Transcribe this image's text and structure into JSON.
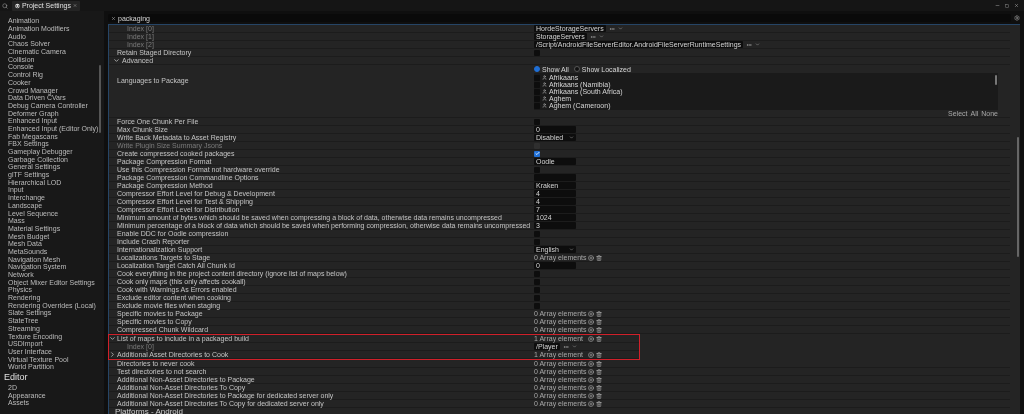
{
  "window": {
    "tab_title": "Project Settings"
  },
  "sidebar": {
    "items": [
      "Animation",
      "Animation Modifiers",
      "Audio",
      "Chaos Solver",
      "Cinematic Camera",
      "Collision",
      "Console",
      "Control Rig",
      "Cooker",
      "Crowd Manager",
      "Data Driven CVars",
      "Debug Camera Controller",
      "Deformer Graph",
      "Enhanced Input",
      "Enhanced Input (Editor Only)",
      "Fab Megascans",
      "FBX Settings",
      "Gameplay Debugger",
      "Garbage Collection",
      "General Settings",
      "glTF Settings",
      "Hierarchical LOD",
      "Input",
      "Interchange",
      "Landscape",
      "Level Sequence",
      "Mass",
      "Material Settings",
      "Mesh Budget",
      "Mesh Data",
      "MetaSounds",
      "Navigation Mesh",
      "Navigation System",
      "Network",
      "Object Mixer Editor Settings",
      "Physics",
      "Rendering",
      "Rendering Overrides (Local)",
      "Slate Settings",
      "StateTree",
      "Streaming",
      "Texture Encoding",
      "USDImport",
      "User Interface",
      "Virtual Texture Pool",
      "World Partition"
    ],
    "editor_section": {
      "heading": "Editor",
      "items": [
        "2D",
        "Appearance",
        "Assets"
      ]
    }
  },
  "search": {
    "value": "packaging"
  },
  "rows": [
    {
      "kind": "index",
      "label": "Index [0]",
      "value": "HordeStorageServers"
    },
    {
      "kind": "index",
      "label": "Index [1]",
      "value": "StorageServers"
    },
    {
      "kind": "index",
      "label": "Index [2]",
      "value": "/Script/AndroidFileServerEditor.AndroidFileServerRuntimeSettings"
    },
    {
      "kind": "checkbox",
      "label": "Retain Staged Directory",
      "checked": false,
      "disabled": false
    },
    {
      "kind": "section",
      "label": "Advanced",
      "expanded": true
    },
    {
      "kind": "languages",
      "label": "Languages to Package",
      "filters": [
        {
          "label": "Show All",
          "selected": true
        },
        {
          "label": "Show Localized",
          "selected": false
        }
      ],
      "languages": [
        {
          "name": "Afrikaans",
          "checked": false
        },
        {
          "name": "Afrikaans (Namibia)",
          "checked": false
        },
        {
          "name": "Afrikaans (South Africa)",
          "checked": false
        },
        {
          "name": "Aghem",
          "checked": false
        },
        {
          "name": "Aghem (Cameroon)",
          "checked": false
        }
      ],
      "select_label": "Select",
      "select_links": [
        "All",
        "None"
      ]
    },
    {
      "kind": "checkbox",
      "label": "Force One Chunk Per File",
      "checked": false,
      "disabled": false
    },
    {
      "kind": "field",
      "label": "Max Chunk Size",
      "value": "0"
    },
    {
      "kind": "dropdown",
      "label": "Write Back Metadata to Asset Registry",
      "value": "Disabled"
    },
    {
      "kind": "checkbox",
      "label": "Write Plugin Size Summary Jsons",
      "checked": false,
      "disabled": true
    },
    {
      "kind": "checkbox",
      "label": "Create compressed cooked packages",
      "checked": true,
      "disabled": false
    },
    {
      "kind": "field",
      "label": "Package Compression Format",
      "value": "Oodle"
    },
    {
      "kind": "checkbox",
      "label": "Use this Compression Format not hardware override",
      "checked": false,
      "disabled": false
    },
    {
      "kind": "field",
      "label": "Package Compression Commandline Options",
      "value": ""
    },
    {
      "kind": "field",
      "label": "Package Compression Method",
      "value": "Kraken"
    },
    {
      "kind": "field",
      "label": "Compressor Effort Level for Debug & Development",
      "value": "4"
    },
    {
      "kind": "field",
      "label": "Compressor Effort Level for Test & Shipping",
      "value": "4"
    },
    {
      "kind": "field",
      "label": "Compressor Effort Level for Distribution",
      "value": "7"
    },
    {
      "kind": "field",
      "label": "Minimum amount of bytes which should be saved when compressing a block of data, otherwise data remains uncompressed",
      "value": "1024"
    },
    {
      "kind": "field",
      "label": "Minimum percentage of a block of data which should be saved when performing compression, otherwise data remains uncompressed",
      "value": "3"
    },
    {
      "kind": "checkbox",
      "label": "Enable DDC for Oodle compression",
      "checked": false,
      "disabled": false
    },
    {
      "kind": "checkbox",
      "label": "Include Crash Reporter",
      "checked": false,
      "disabled": false
    },
    {
      "kind": "dropdown",
      "label": "Internationalization Support",
      "value": "English"
    },
    {
      "kind": "array",
      "label": "Localizations Targets to Stage",
      "value": "0 Array elements"
    },
    {
      "kind": "field",
      "label": "Localization Target Catch All Chunk Id",
      "value": "0"
    },
    {
      "kind": "checkbox",
      "label": "Cook everything in the project content directory (ignore list of maps below)",
      "checked": false,
      "disabled": false
    },
    {
      "kind": "checkbox",
      "label": "Cook only maps (this only affects cookall)",
      "checked": false,
      "disabled": false
    },
    {
      "kind": "checkbox",
      "label": "Cook with Warnings As Errors enabled",
      "checked": false,
      "disabled": false
    },
    {
      "kind": "checkbox",
      "label": "Exclude editor content when cooking",
      "checked": false,
      "disabled": false
    },
    {
      "kind": "checkbox",
      "label": "Exclude movie files when staging",
      "checked": false,
      "disabled": false
    },
    {
      "kind": "array",
      "label": "Specific movies to Package",
      "value": "0 Array elements"
    },
    {
      "kind": "array",
      "label": "Specific movies to Copy",
      "value": "0 Array elements"
    },
    {
      "kind": "array",
      "label": "Compressed Chunk Wildcard",
      "value": "0 Array elements"
    },
    {
      "kind": "group",
      "rows": [
        {
          "kind": "array",
          "label": "List of maps to include in a packaged build",
          "value": "1 Array element",
          "expanded": true
        },
        {
          "kind": "index",
          "label": "Index [0]",
          "value": "/Player"
        },
        {
          "kind": "array",
          "label": "Additional Asset Directories to Cook",
          "value": "1 Array element",
          "expanded": false
        }
      ]
    },
    {
      "kind": "array",
      "label": "Directories to never cook",
      "value": "0 Array elements"
    },
    {
      "kind": "array",
      "label": "Test directories to not search",
      "value": "0 Array elements"
    },
    {
      "kind": "array",
      "label": "Additional Non-Asset Directories to Package",
      "value": "0 Array elements"
    },
    {
      "kind": "array",
      "label": "Additional Non-Asset Directories To Copy",
      "value": "0 Array elements"
    },
    {
      "kind": "array",
      "label": "Additional Non-Asset Directories to Package for dedicated server only",
      "value": "0 Array elements"
    },
    {
      "kind": "array",
      "label": "Additional Non-Asset Directories To Copy for dedicated server only",
      "value": "0 Array elements"
    }
  ],
  "footer_heading": "Platforms - Android"
}
